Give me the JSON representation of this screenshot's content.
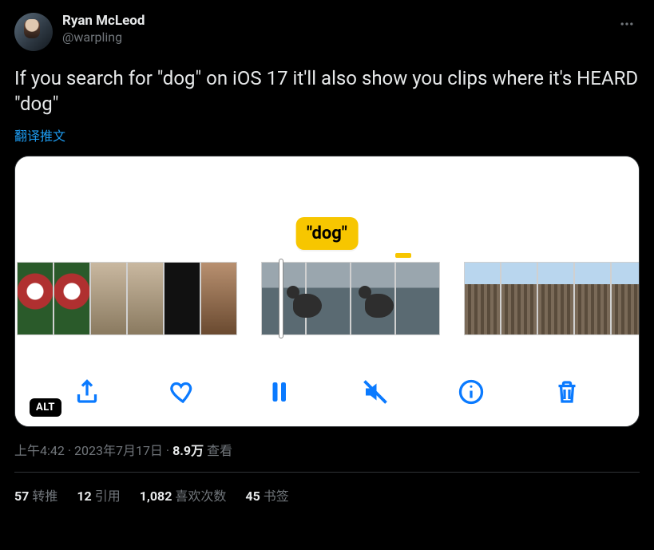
{
  "author": {
    "display_name": "Ryan McLeod",
    "handle": "@warpling"
  },
  "tweet_text": "If you search for \"dog\" on iOS 17 it'll also show you clips where it's HEARD \"dog\"",
  "translate_label": "翻译推文",
  "media": {
    "caption_bubble": "\"dog\"",
    "alt_badge": "ALT",
    "toolbar_icons": [
      "share",
      "heart",
      "pause",
      "mute",
      "info",
      "trash"
    ]
  },
  "meta": {
    "time": "上午4:42",
    "date": "2023年7月17日",
    "views_number": "8.9万",
    "views_label": "查看",
    "separator": " · "
  },
  "stats": {
    "retweets": {
      "count": "57",
      "label": "转推"
    },
    "quotes": {
      "count": "12",
      "label": "引用"
    },
    "likes": {
      "count": "1,082",
      "label": "喜欢次数"
    },
    "bookmarks": {
      "count": "45",
      "label": "书签"
    }
  }
}
